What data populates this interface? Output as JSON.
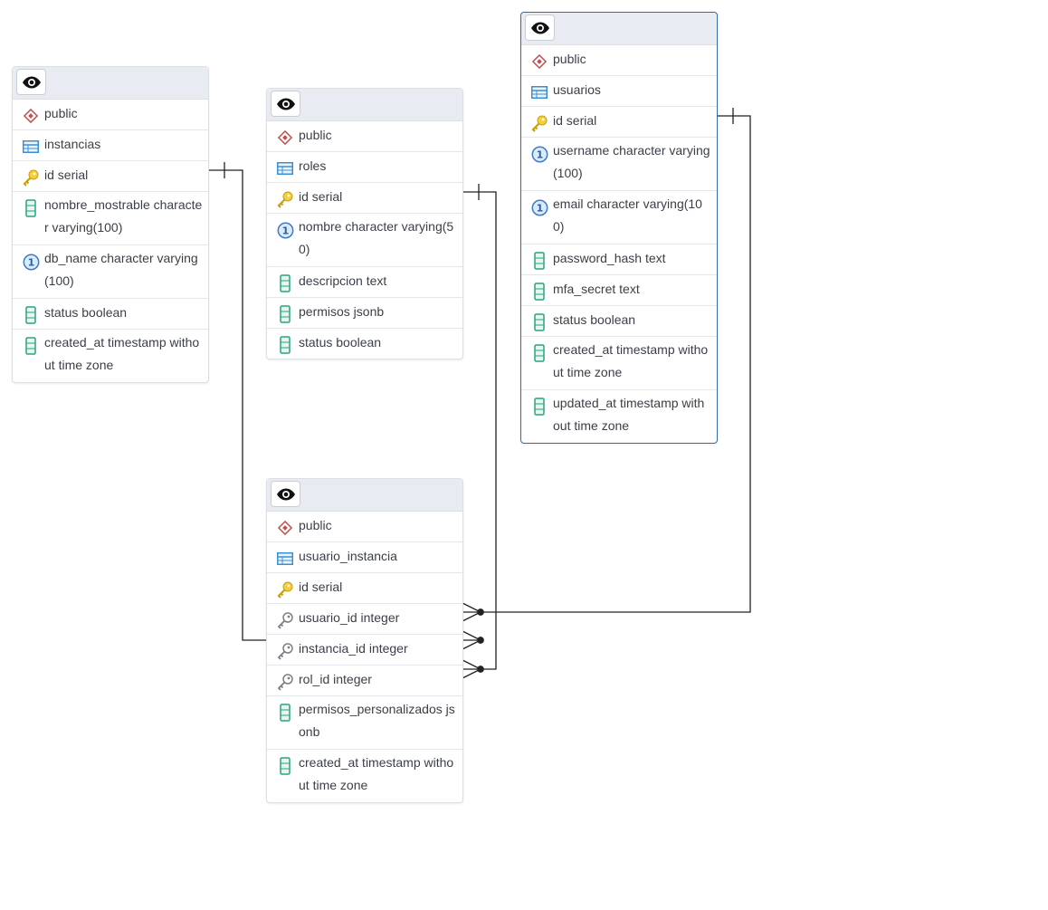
{
  "tables": {
    "instancias": {
      "schema": "public",
      "name": "instancias",
      "columns": [
        {
          "label": "id serial",
          "icon": "primary-key-icon"
        },
        {
          "label": "nombre_mostrable character varying(100)",
          "icon": "column-icon"
        },
        {
          "label": "db_name character varying(100)",
          "icon": "unique-constraint-icon"
        },
        {
          "label": "status boolean",
          "icon": "column-icon"
        },
        {
          "label": "created_at timestamp without time zone",
          "icon": "column-icon"
        }
      ]
    },
    "roles": {
      "schema": "public",
      "name": "roles",
      "columns": [
        {
          "label": "id serial",
          "icon": "primary-key-icon"
        },
        {
          "label": "nombre character varying(50)",
          "icon": "unique-constraint-icon"
        },
        {
          "label": "descripcion text",
          "icon": "column-icon"
        },
        {
          "label": "permisos jsonb",
          "icon": "column-icon"
        },
        {
          "label": "status boolean",
          "icon": "column-icon"
        }
      ]
    },
    "usuarios": {
      "schema": "public",
      "name": "usuarios",
      "columns": [
        {
          "label": "id serial",
          "icon": "primary-key-icon"
        },
        {
          "label": "username character varying(100)",
          "icon": "unique-constraint-icon"
        },
        {
          "label": "email character varying(100)",
          "icon": "unique-constraint-icon"
        },
        {
          "label": "password_hash text",
          "icon": "column-icon"
        },
        {
          "label": "mfa_secret text",
          "icon": "column-icon"
        },
        {
          "label": "status boolean",
          "icon": "column-icon"
        },
        {
          "label": "created_at timestamp without time zone",
          "icon": "column-icon"
        },
        {
          "label": "updated_at timestamp without time zone",
          "icon": "column-icon"
        }
      ]
    },
    "usuario_instancia": {
      "schema": "public",
      "name": "usuario_instancia",
      "columns": [
        {
          "label": "id serial",
          "icon": "primary-key-icon"
        },
        {
          "label": "usuario_id integer",
          "icon": "foreign-key-icon"
        },
        {
          "label": "instancia_id integer",
          "icon": "foreign-key-icon"
        },
        {
          "label": "rol_id integer",
          "icon": "foreign-key-icon"
        },
        {
          "label": "permisos_personalizados jsonb",
          "icon": "column-icon"
        },
        {
          "label": "created_at timestamp without time zone",
          "icon": "column-icon"
        }
      ]
    }
  },
  "relations": [
    {
      "from": "usuario_instancia.usuario_id",
      "to": "usuarios.id",
      "cardinality": "many-to-one"
    },
    {
      "from": "usuario_instancia.instancia_id",
      "to": "instancias.id",
      "cardinality": "many-to-one"
    },
    {
      "from": "usuario_instancia.rol_id",
      "to": "roles.id",
      "cardinality": "many-to-one"
    }
  ],
  "colors": {
    "selected_border": "#326da8",
    "header_bg": "#e8ebf1",
    "line": "#222222",
    "schema_icon": "#c0504d",
    "table_icon": "#3d8fd1",
    "pk_icon": "#e6b91e",
    "column_icon": "#2aa37f",
    "unique_icon": "#3d7ac7",
    "fk_icon": "#7b7f86"
  }
}
